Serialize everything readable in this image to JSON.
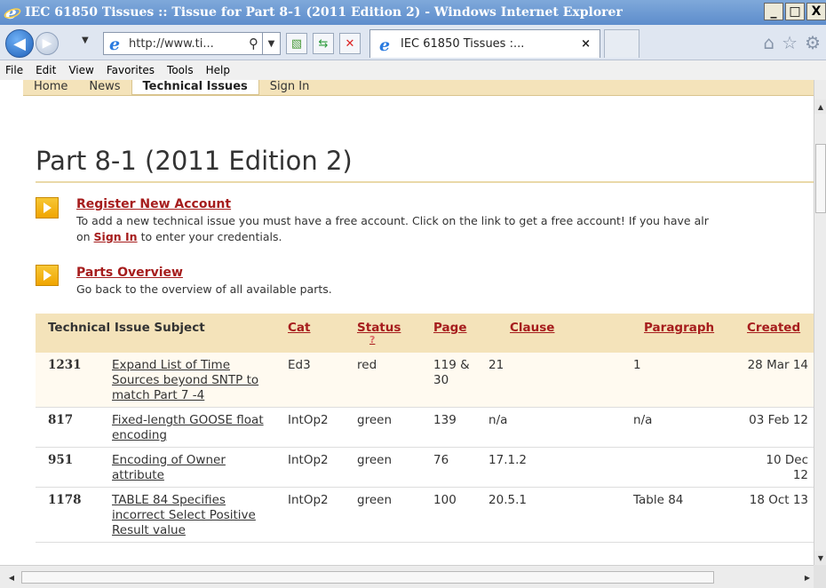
{
  "window": {
    "title": "IEC 61850 Tissues :: Tissue for Part 8-1 (2011 Edition 2) - Windows Internet Explorer",
    "minimize": "_",
    "maximize": "□",
    "close": "X"
  },
  "navbar": {
    "address": "http://www.ti...",
    "tab_title": "IEC 61850 Tissues :...",
    "tab_close": "×"
  },
  "menu": [
    "File",
    "Edit",
    "View",
    "Favorites",
    "Tools",
    "Help"
  ],
  "site_nav": [
    {
      "label": "Home",
      "active": false
    },
    {
      "label": "News",
      "active": false
    },
    {
      "label": "Technical Issues",
      "active": true
    },
    {
      "label": "Sign In",
      "active": false
    }
  ],
  "page": {
    "title": "Part 8-1 (2011 Edition 2)",
    "register": {
      "link": "Register New Account",
      "desc_line1": "To add a new technical issue you must have a free account. Click on the link to get a free account! If you have alr",
      "desc_line2_pre": "on ",
      "desc_line2_link": "Sign In",
      "desc_line2_post": " to enter your credentials."
    },
    "parts": {
      "link": "Parts Overview",
      "desc": "Go back to the overview of all available parts."
    }
  },
  "table": {
    "headers": {
      "subject": "Technical Issue Subject",
      "cat": "Cat",
      "status": "Status",
      "status_q": "?",
      "page": "Page",
      "clause": "Clause",
      "paragraph": "Paragraph",
      "created": "Created"
    },
    "rows": [
      {
        "id": "1231",
        "subject": "Expand List of Time Sources beyond SNTP to match Part 7 -4",
        "cat": "Ed3",
        "status": "red",
        "page": "119 & 30",
        "clause": "21",
        "paragraph": "1",
        "created": "28 Mar 14"
      },
      {
        "id": "817",
        "subject": "Fixed-length GOOSE float encoding",
        "cat": "IntOp2",
        "status": "green",
        "page": "139",
        "clause": "n/a",
        "paragraph": "n/a",
        "created": "03 Feb 12"
      },
      {
        "id": "951",
        "subject": "Encoding of Owner attribute",
        "cat": "IntOp2",
        "status": "green",
        "page": "76",
        "clause": "17.1.2",
        "paragraph": "",
        "created": "10 Dec 12"
      },
      {
        "id": "1178",
        "subject": "TABLE 84 Specifies incorrect Select Positive Result value",
        "cat": "IntOp2",
        "status": "green",
        "page": "100",
        "clause": "20.5.1",
        "paragraph": "Table 84",
        "created": "18 Oct 13"
      }
    ]
  }
}
